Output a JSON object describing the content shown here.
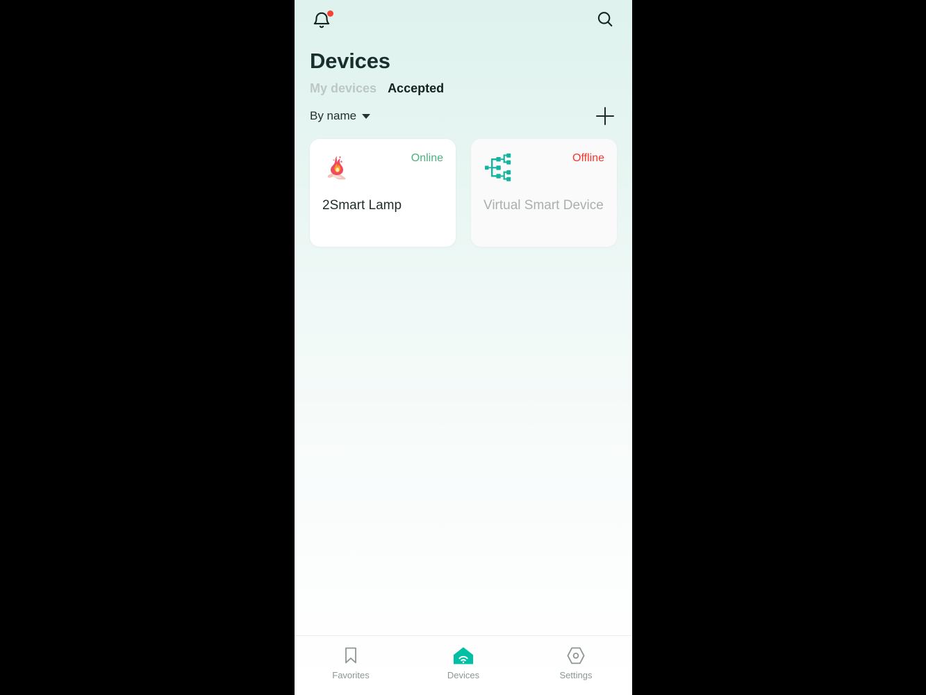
{
  "app": {
    "title": "Devices",
    "theme": {
      "accent": "#00bfa5",
      "background_top": "#dff2ee",
      "background_bottom": "#ffffff",
      "online_color": "#4caf7d",
      "offline_color": "#f6352d",
      "badge_color": "#f44336",
      "title_color": "#17302c"
    }
  },
  "topbar": {
    "notifications_icon": "bell-icon",
    "notifications_badge": true,
    "search_icon": "search-icon"
  },
  "tabs": [
    {
      "label": "My devices",
      "active": false
    },
    {
      "label": "Accepted",
      "active": true
    }
  ],
  "sort": {
    "label": "By name",
    "caret_icon": "chevron-down-icon",
    "options": [
      "By name"
    ]
  },
  "actions": {
    "add_label": "+",
    "add_icon": "plus-icon"
  },
  "devices": [
    {
      "name": "2Smart Lamp",
      "status": "Online",
      "state": "online",
      "icon": "flame-in-hand-icon"
    },
    {
      "name": "Virtual Smart Device",
      "status": "Offline",
      "state": "offline",
      "icon": "sitemap-icon"
    }
  ],
  "bottom_nav": [
    {
      "label": "Favorites",
      "icon": "bookmark-icon",
      "active": false
    },
    {
      "label": "Devices",
      "icon": "home-wifi-icon",
      "active": true
    },
    {
      "label": "Settings",
      "icon": "hex-nut-icon",
      "active": false
    }
  ]
}
